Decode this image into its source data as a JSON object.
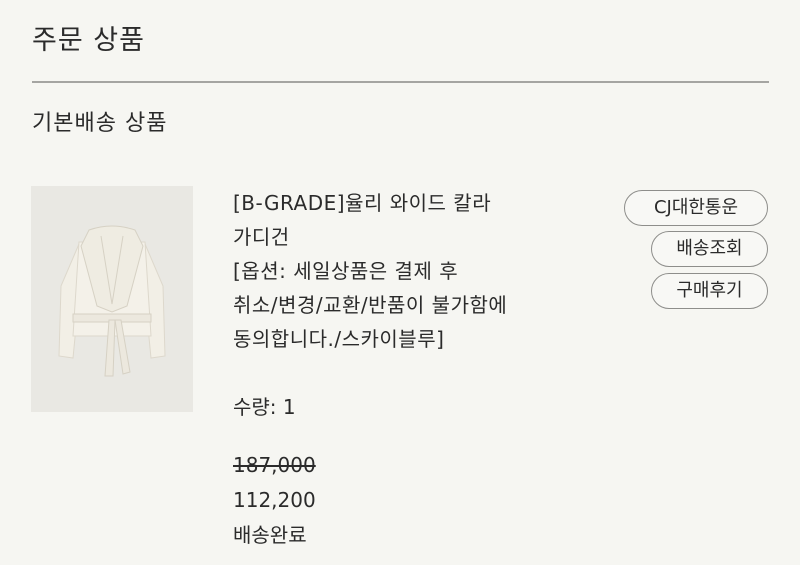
{
  "header": {
    "title": "주문 상품"
  },
  "section": {
    "title": "기본배송 상품"
  },
  "product": {
    "image_alt": "cardigan-product-image",
    "name_lines": [
      "[B-GRADE]율리 와이드 칼라",
      "가디건",
      "[옵션: 세일상품은 결제 후",
      "취소/변경/교환/반품이 불가함에",
      "동의합니다./스카이블루]"
    ],
    "quantity": "수량: 1",
    "original_price": "187,000",
    "sale_price": "112,200",
    "shipping_status": "배송완료"
  },
  "actions": {
    "courier_label": "CJ대한통운",
    "track_label": "배송조회",
    "review_label": "구매후기"
  }
}
